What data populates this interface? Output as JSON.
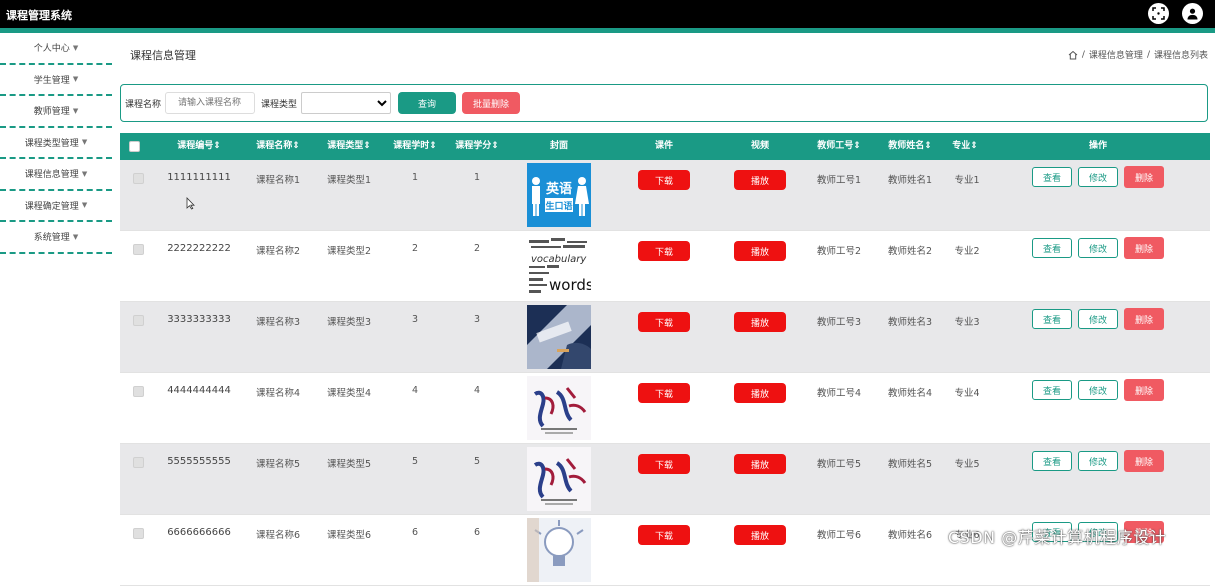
{
  "app": {
    "title": "课程管理系统"
  },
  "sidebar": {
    "items": [
      {
        "label": "个人中心"
      },
      {
        "label": "学生管理"
      },
      {
        "label": "教师管理"
      },
      {
        "label": "课程类型管理"
      },
      {
        "label": "课程信息管理"
      },
      {
        "label": "课程确定管理"
      },
      {
        "label": "系统管理"
      }
    ]
  },
  "page": {
    "title": "课程信息管理",
    "breadcrumb": [
      "课程信息管理",
      "课程信息列表"
    ]
  },
  "search": {
    "name_label": "课程名称",
    "name_placeholder": "请输入课程名称",
    "type_label": "课程类型",
    "type_value": "",
    "query_button": "查询",
    "batch_delete_button": "批量删除"
  },
  "table": {
    "headers": {
      "code": "课程编号",
      "name": "课程名称",
      "type": "课程类型",
      "hours": "课程学时",
      "credits": "课程学分",
      "cover": "封面",
      "courseware": "课件",
      "video": "视频",
      "teacher_no": "教师工号",
      "teacher_name": "教师姓名",
      "major": "专业",
      "actions": "操作"
    },
    "sort_icon": "⇕",
    "rows": [
      {
        "code": "1111111111",
        "name": "课程名称1",
        "type": "课程类型1",
        "hours": "1",
        "credits": "1",
        "teacher_no": "教师工号1",
        "teacher_name": "教师姓名1",
        "major": "专业1",
        "cover": "english"
      },
      {
        "code": "2222222222",
        "name": "课程名称2",
        "type": "课程类型2",
        "hours": "2",
        "credits": "2",
        "teacher_no": "教师工号2",
        "teacher_name": "教师姓名2",
        "major": "专业2",
        "cover": "words"
      },
      {
        "code": "3333333333",
        "name": "课程名称3",
        "type": "课程类型3",
        "hours": "3",
        "credits": "3",
        "teacher_no": "教师工号3",
        "teacher_name": "教师姓名3",
        "major": "专业3",
        "cover": "business"
      },
      {
        "code": "4444444444",
        "name": "课程名称4",
        "type": "课程类型4",
        "hours": "4",
        "credits": "4",
        "teacher_no": "教师工号4",
        "teacher_name": "教师姓名4",
        "major": "专业4",
        "cover": "calligraphy"
      },
      {
        "code": "5555555555",
        "name": "课程名称5",
        "type": "课程类型5",
        "hours": "5",
        "credits": "5",
        "teacher_no": "教师工号5",
        "teacher_name": "教师姓名5",
        "major": "专业5",
        "cover": "calligraphy"
      },
      {
        "code": "6666666666",
        "name": "课程名称6",
        "type": "课程类型6",
        "hours": "6",
        "credits": "6",
        "teacher_no": "教师工号6",
        "teacher_name": "教师姓名6",
        "major": "专业6",
        "cover": "lightbulb"
      }
    ],
    "row_buttons": {
      "download": "下载",
      "play": "播放",
      "view": "查看",
      "edit": "修改",
      "delete": "删除"
    }
  },
  "cover_text": {
    "english_cn": "英语",
    "english_sub": "生口语",
    "words_big": "words",
    "words_small": "vocabulary"
  },
  "watermark": "CSDN @芹菜计算机程序设计",
  "colors": {
    "accent": "#1a9a85",
    "danger": "#ee1111",
    "delete": "#f05a62"
  }
}
